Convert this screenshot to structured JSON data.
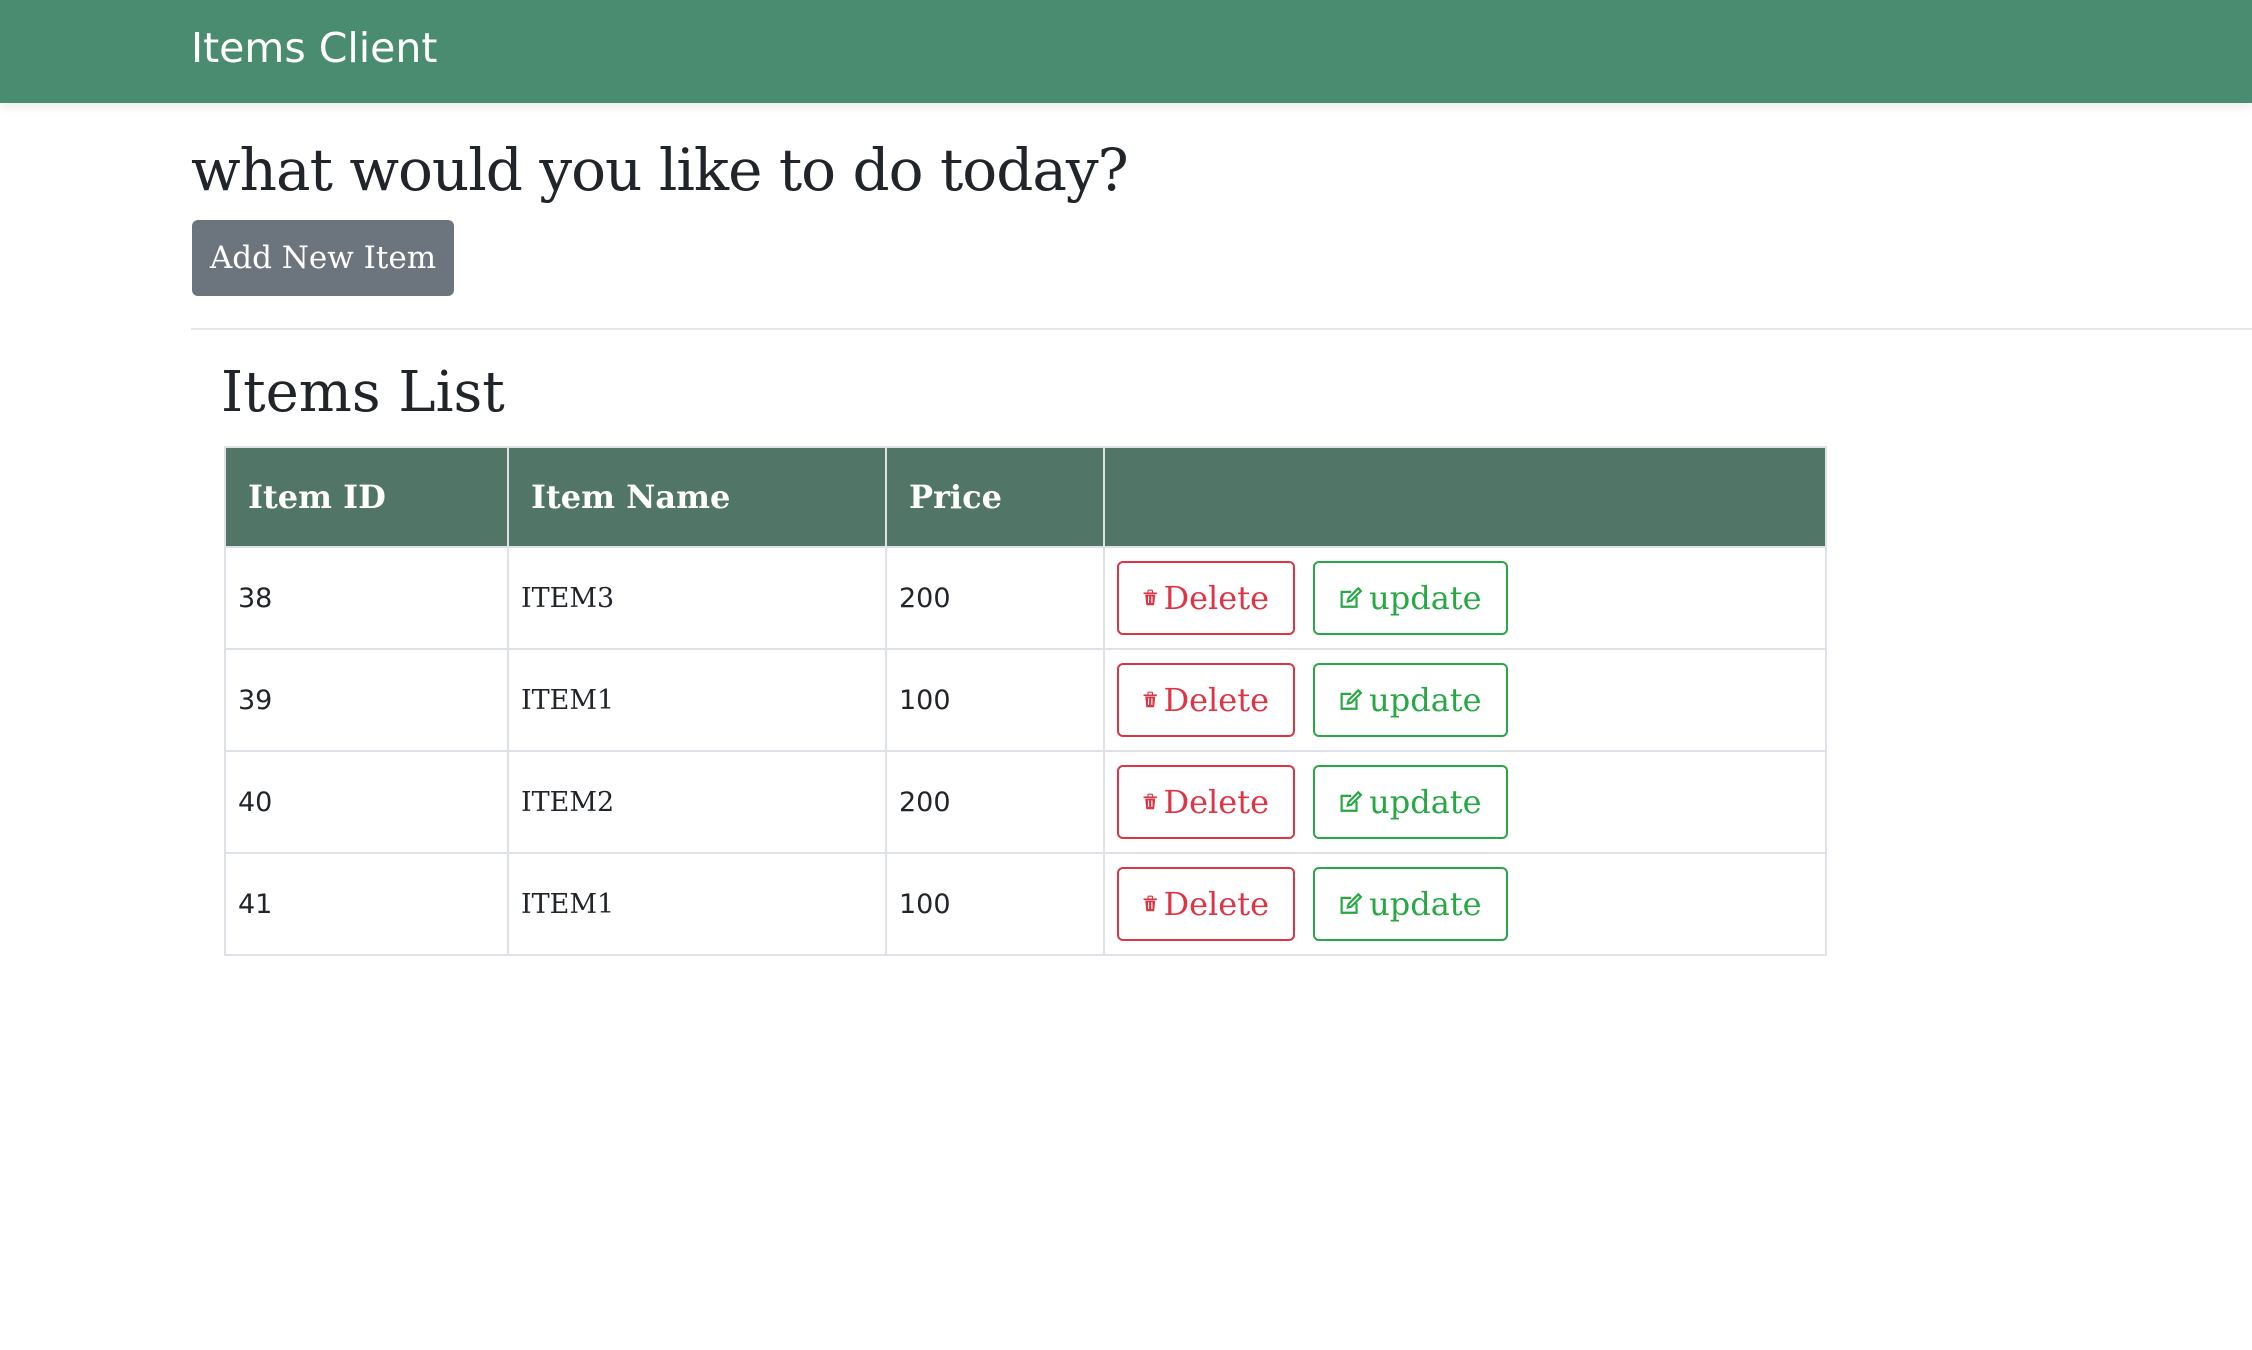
{
  "app": {
    "brand": "Items Client"
  },
  "main": {
    "heading": "what would you like to do today?",
    "add_button_label": "Add New Item",
    "list_title": "Items List"
  },
  "table": {
    "headers": [
      "Item ID",
      "Item Name",
      "Price",
      ""
    ],
    "rows": [
      {
        "id": "38",
        "name": "ITEM3",
        "price": "200"
      },
      {
        "id": "39",
        "name": "ITEM1",
        "price": "100"
      },
      {
        "id": "40",
        "name": "ITEM2",
        "price": "200"
      },
      {
        "id": "41",
        "name": "ITEM1",
        "price": "100"
      }
    ],
    "delete_label": "Delete",
    "update_label": "update",
    "delete_icon": "trash-icon",
    "update_icon": "edit-icon"
  },
  "colors": {
    "navbar": "#4a8c6f",
    "table_header": "#517566",
    "delete": "#dc3545",
    "update": "#28a745",
    "add_button": "#6c757d"
  }
}
